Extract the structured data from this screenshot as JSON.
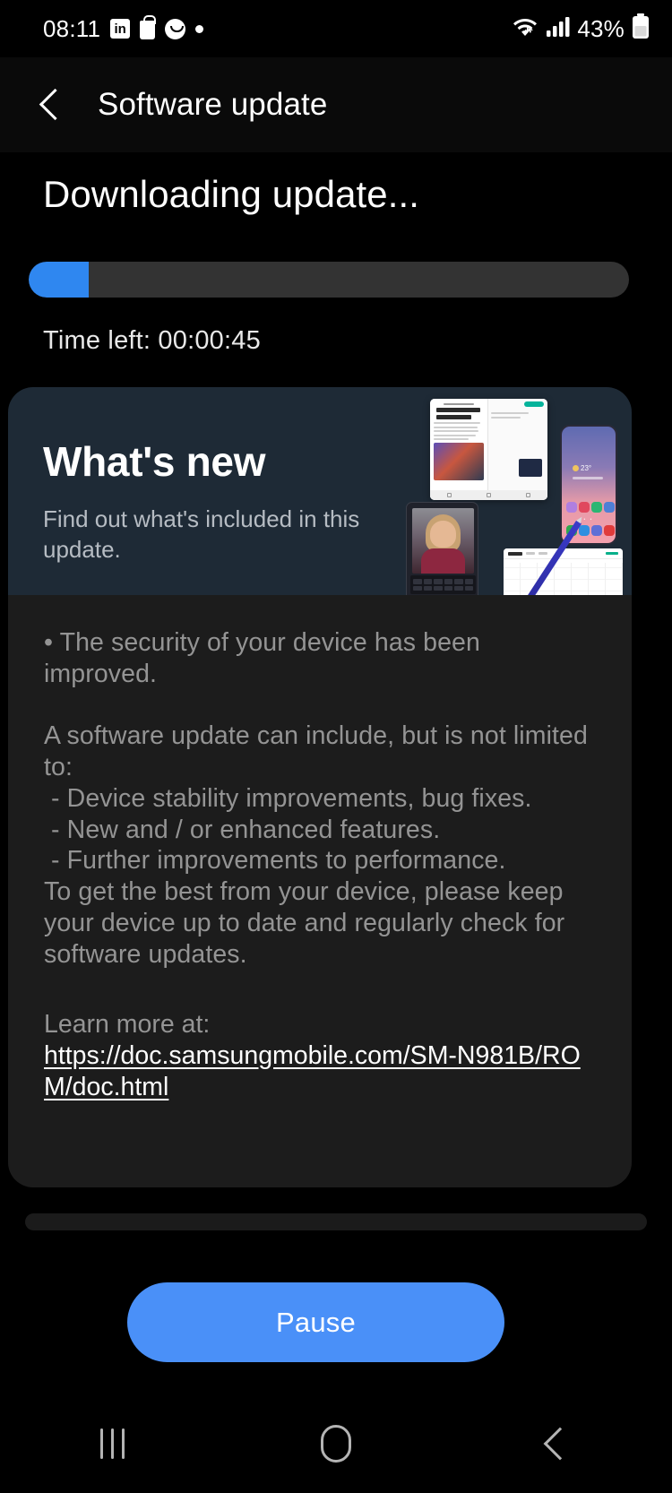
{
  "status_bar": {
    "time": "08:11",
    "left_icons": [
      "linkedin-icon",
      "shopping-bag-icon",
      "smiley-icon",
      "dot-icon"
    ],
    "right_icons": [
      "wifi-icon",
      "cellular-signal-icon"
    ],
    "battery_percent": "43%"
  },
  "app_bar": {
    "back_label": "back-icon",
    "title": "Software update"
  },
  "download": {
    "heading": "Downloading update...",
    "progress_percent": 10,
    "progress_fill_color": "#2f87f0",
    "progress_track_color": "#333333",
    "time_left": "Time left: 00:00:45"
  },
  "whats_new": {
    "title": "What's new",
    "subtitle": "Find out what's included in this update.",
    "background_color": "#1e2a36"
  },
  "release_notes": {
    "body": "• The security of your device has been improved.\n\nA software update can include, but is not limited to:\n - Device stability improvements, bug fixes.\n - New and / or enhanced features.\n - Further improvements to performance.\nTo get the best from your device, please keep your device up to date and regularly check for software updates.",
    "learn_more_label": "Learn more at:",
    "learn_more_url": "https://doc.samsungmobile.com/SM-N981B/ROM/doc.html"
  },
  "actions": {
    "pause_label": "Pause",
    "pause_color": "#4a90f8"
  },
  "nav_bar": {
    "recents_label": "recents-icon",
    "home_label": "home-icon",
    "back_label": "back-icon"
  }
}
